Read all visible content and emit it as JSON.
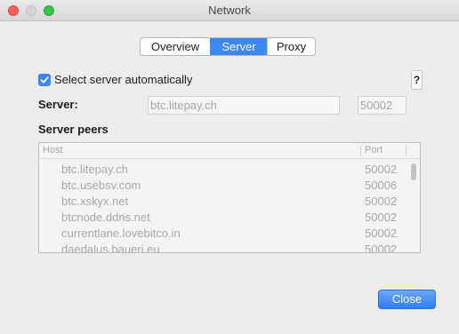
{
  "window": {
    "title": "Network"
  },
  "tabs": [
    {
      "label": "Overview",
      "active": false
    },
    {
      "label": "Server",
      "active": true
    },
    {
      "label": "Proxy",
      "active": false
    }
  ],
  "auto_select": {
    "label": "Select server automatically",
    "checked": true
  },
  "help_label": "?",
  "server": {
    "label": "Server:",
    "host_value": "btc.litepay.ch",
    "port_value": "50002"
  },
  "peers": {
    "label": "Server peers",
    "columns": [
      "Host",
      "Port"
    ],
    "rows": [
      {
        "host": "btc.litepay.ch",
        "port": "50002"
      },
      {
        "host": "btc.usebsv.com",
        "port": "50006"
      },
      {
        "host": "btc.xskyx.net",
        "port": "50002"
      },
      {
        "host": "btcnode.ddns.net",
        "port": "50002"
      },
      {
        "host": "currentlane.lovebitco.in",
        "port": "50002"
      },
      {
        "host": "daedalus.bauerj.eu",
        "port": "50002"
      }
    ]
  },
  "close_label": "Close",
  "colors": {
    "accent": "#3b87f5",
    "disabled_text": "#a8a8a8"
  }
}
